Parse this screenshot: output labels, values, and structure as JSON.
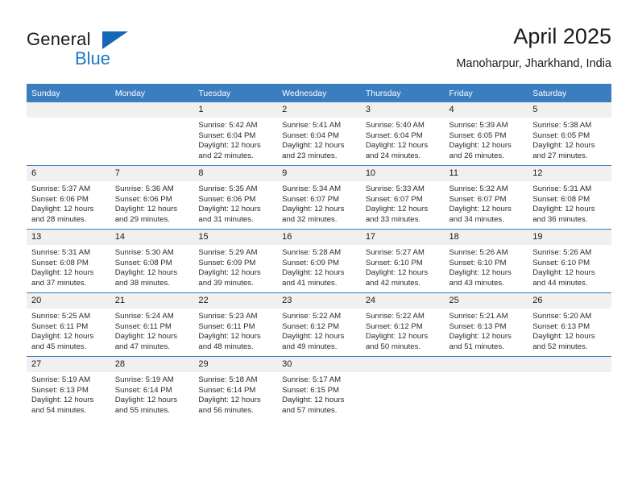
{
  "brand": {
    "name_part1": "General",
    "name_part2": "Blue",
    "accent_color": "#1b77c9",
    "triangle_color": "#1667b3"
  },
  "header": {
    "title": "April 2025",
    "subtitle": "Manoharpur, Jharkhand, India"
  },
  "calendar": {
    "header_bg": "#3a7dc0",
    "daynum_bg": "#f0f0f0",
    "weekdays": [
      "Sunday",
      "Monday",
      "Tuesday",
      "Wednesday",
      "Thursday",
      "Friday",
      "Saturday"
    ],
    "weeks": [
      [
        {
          "day": "",
          "sunrise": "",
          "sunset": "",
          "daylight_line1": "",
          "daylight_line2": "",
          "empty": true
        },
        {
          "day": "",
          "sunrise": "",
          "sunset": "",
          "daylight_line1": "",
          "daylight_line2": "",
          "empty": true
        },
        {
          "day": "1",
          "sunrise": "Sunrise: 5:42 AM",
          "sunset": "Sunset: 6:04 PM",
          "daylight_line1": "Daylight: 12 hours",
          "daylight_line2": "and 22 minutes.",
          "empty": false
        },
        {
          "day": "2",
          "sunrise": "Sunrise: 5:41 AM",
          "sunset": "Sunset: 6:04 PM",
          "daylight_line1": "Daylight: 12 hours",
          "daylight_line2": "and 23 minutes.",
          "empty": false
        },
        {
          "day": "3",
          "sunrise": "Sunrise: 5:40 AM",
          "sunset": "Sunset: 6:04 PM",
          "daylight_line1": "Daylight: 12 hours",
          "daylight_line2": "and 24 minutes.",
          "empty": false
        },
        {
          "day": "4",
          "sunrise": "Sunrise: 5:39 AM",
          "sunset": "Sunset: 6:05 PM",
          "daylight_line1": "Daylight: 12 hours",
          "daylight_line2": "and 26 minutes.",
          "empty": false
        },
        {
          "day": "5",
          "sunrise": "Sunrise: 5:38 AM",
          "sunset": "Sunset: 6:05 PM",
          "daylight_line1": "Daylight: 12 hours",
          "daylight_line2": "and 27 minutes.",
          "empty": false
        }
      ],
      [
        {
          "day": "6",
          "sunrise": "Sunrise: 5:37 AM",
          "sunset": "Sunset: 6:06 PM",
          "daylight_line1": "Daylight: 12 hours",
          "daylight_line2": "and 28 minutes.",
          "empty": false
        },
        {
          "day": "7",
          "sunrise": "Sunrise: 5:36 AM",
          "sunset": "Sunset: 6:06 PM",
          "daylight_line1": "Daylight: 12 hours",
          "daylight_line2": "and 29 minutes.",
          "empty": false
        },
        {
          "day": "8",
          "sunrise": "Sunrise: 5:35 AM",
          "sunset": "Sunset: 6:06 PM",
          "daylight_line1": "Daylight: 12 hours",
          "daylight_line2": "and 31 minutes.",
          "empty": false
        },
        {
          "day": "9",
          "sunrise": "Sunrise: 5:34 AM",
          "sunset": "Sunset: 6:07 PM",
          "daylight_line1": "Daylight: 12 hours",
          "daylight_line2": "and 32 minutes.",
          "empty": false
        },
        {
          "day": "10",
          "sunrise": "Sunrise: 5:33 AM",
          "sunset": "Sunset: 6:07 PM",
          "daylight_line1": "Daylight: 12 hours",
          "daylight_line2": "and 33 minutes.",
          "empty": false
        },
        {
          "day": "11",
          "sunrise": "Sunrise: 5:32 AM",
          "sunset": "Sunset: 6:07 PM",
          "daylight_line1": "Daylight: 12 hours",
          "daylight_line2": "and 34 minutes.",
          "empty": false
        },
        {
          "day": "12",
          "sunrise": "Sunrise: 5:31 AM",
          "sunset": "Sunset: 6:08 PM",
          "daylight_line1": "Daylight: 12 hours",
          "daylight_line2": "and 36 minutes.",
          "empty": false
        }
      ],
      [
        {
          "day": "13",
          "sunrise": "Sunrise: 5:31 AM",
          "sunset": "Sunset: 6:08 PM",
          "daylight_line1": "Daylight: 12 hours",
          "daylight_line2": "and 37 minutes.",
          "empty": false
        },
        {
          "day": "14",
          "sunrise": "Sunrise: 5:30 AM",
          "sunset": "Sunset: 6:08 PM",
          "daylight_line1": "Daylight: 12 hours",
          "daylight_line2": "and 38 minutes.",
          "empty": false
        },
        {
          "day": "15",
          "sunrise": "Sunrise: 5:29 AM",
          "sunset": "Sunset: 6:09 PM",
          "daylight_line1": "Daylight: 12 hours",
          "daylight_line2": "and 39 minutes.",
          "empty": false
        },
        {
          "day": "16",
          "sunrise": "Sunrise: 5:28 AM",
          "sunset": "Sunset: 6:09 PM",
          "daylight_line1": "Daylight: 12 hours",
          "daylight_line2": "and 41 minutes.",
          "empty": false
        },
        {
          "day": "17",
          "sunrise": "Sunrise: 5:27 AM",
          "sunset": "Sunset: 6:10 PM",
          "daylight_line1": "Daylight: 12 hours",
          "daylight_line2": "and 42 minutes.",
          "empty": false
        },
        {
          "day": "18",
          "sunrise": "Sunrise: 5:26 AM",
          "sunset": "Sunset: 6:10 PM",
          "daylight_line1": "Daylight: 12 hours",
          "daylight_line2": "and 43 minutes.",
          "empty": false
        },
        {
          "day": "19",
          "sunrise": "Sunrise: 5:26 AM",
          "sunset": "Sunset: 6:10 PM",
          "daylight_line1": "Daylight: 12 hours",
          "daylight_line2": "and 44 minutes.",
          "empty": false
        }
      ],
      [
        {
          "day": "20",
          "sunrise": "Sunrise: 5:25 AM",
          "sunset": "Sunset: 6:11 PM",
          "daylight_line1": "Daylight: 12 hours",
          "daylight_line2": "and 45 minutes.",
          "empty": false
        },
        {
          "day": "21",
          "sunrise": "Sunrise: 5:24 AM",
          "sunset": "Sunset: 6:11 PM",
          "daylight_line1": "Daylight: 12 hours",
          "daylight_line2": "and 47 minutes.",
          "empty": false
        },
        {
          "day": "22",
          "sunrise": "Sunrise: 5:23 AM",
          "sunset": "Sunset: 6:11 PM",
          "daylight_line1": "Daylight: 12 hours",
          "daylight_line2": "and 48 minutes.",
          "empty": false
        },
        {
          "day": "23",
          "sunrise": "Sunrise: 5:22 AM",
          "sunset": "Sunset: 6:12 PM",
          "daylight_line1": "Daylight: 12 hours",
          "daylight_line2": "and 49 minutes.",
          "empty": false
        },
        {
          "day": "24",
          "sunrise": "Sunrise: 5:22 AM",
          "sunset": "Sunset: 6:12 PM",
          "daylight_line1": "Daylight: 12 hours",
          "daylight_line2": "and 50 minutes.",
          "empty": false
        },
        {
          "day": "25",
          "sunrise": "Sunrise: 5:21 AM",
          "sunset": "Sunset: 6:13 PM",
          "daylight_line1": "Daylight: 12 hours",
          "daylight_line2": "and 51 minutes.",
          "empty": false
        },
        {
          "day": "26",
          "sunrise": "Sunrise: 5:20 AM",
          "sunset": "Sunset: 6:13 PM",
          "daylight_line1": "Daylight: 12 hours",
          "daylight_line2": "and 52 minutes.",
          "empty": false
        }
      ],
      [
        {
          "day": "27",
          "sunrise": "Sunrise: 5:19 AM",
          "sunset": "Sunset: 6:13 PM",
          "daylight_line1": "Daylight: 12 hours",
          "daylight_line2": "and 54 minutes.",
          "empty": false
        },
        {
          "day": "28",
          "sunrise": "Sunrise: 5:19 AM",
          "sunset": "Sunset: 6:14 PM",
          "daylight_line1": "Daylight: 12 hours",
          "daylight_line2": "and 55 minutes.",
          "empty": false
        },
        {
          "day": "29",
          "sunrise": "Sunrise: 5:18 AM",
          "sunset": "Sunset: 6:14 PM",
          "daylight_line1": "Daylight: 12 hours",
          "daylight_line2": "and 56 minutes.",
          "empty": false
        },
        {
          "day": "30",
          "sunrise": "Sunrise: 5:17 AM",
          "sunset": "Sunset: 6:15 PM",
          "daylight_line1": "Daylight: 12 hours",
          "daylight_line2": "and 57 minutes.",
          "empty": false
        },
        {
          "day": "",
          "sunrise": "",
          "sunset": "",
          "daylight_line1": "",
          "daylight_line2": "",
          "empty": true
        },
        {
          "day": "",
          "sunrise": "",
          "sunset": "",
          "daylight_line1": "",
          "daylight_line2": "",
          "empty": true
        },
        {
          "day": "",
          "sunrise": "",
          "sunset": "",
          "daylight_line1": "",
          "daylight_line2": "",
          "empty": true
        }
      ]
    ]
  }
}
